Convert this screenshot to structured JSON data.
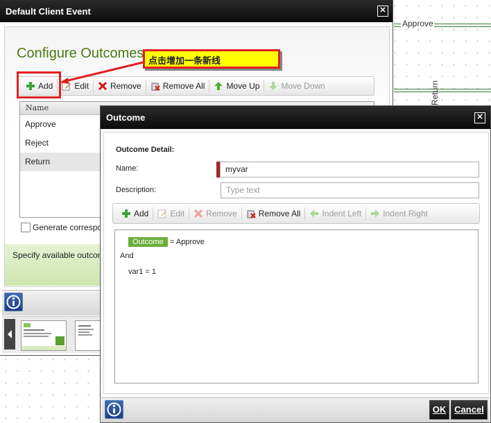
{
  "canvas": {
    "label_approve": "Approve",
    "label_return": "Return"
  },
  "main_dialog": {
    "title": "Default Client Event",
    "heading": "Configure Outcomes",
    "toolbar": {
      "add": "Add",
      "edit": "Edit",
      "remove": "Remove",
      "remove_all": "Remove All",
      "move_up": "Move Up",
      "move_down": "Move Down"
    },
    "list": {
      "header": "Name",
      "items": [
        "Approve",
        "Reject",
        "Return"
      ],
      "selected_index": 2
    },
    "checkbox_label": "Generate correspor",
    "info_text": "Specify available outcome"
  },
  "annotation": {
    "text": "点击增加一条新线"
  },
  "outcome_dialog": {
    "title": "Outcome",
    "section_title": "Outcome Detail:",
    "name_label": "Name:",
    "name_value": "myvar",
    "description_label": "Description:",
    "description_placeholder": "Type text",
    "toolbar": {
      "add": "Add",
      "edit": "Edit",
      "remove": "Remove",
      "remove_all": "Remove All",
      "indent_left": "Indent Left",
      "indent_right": "Indent Right"
    },
    "expression": {
      "tag": "Outcome",
      "line1_rest": "= Approve",
      "line2": "And",
      "line3": "var1 = 1"
    },
    "ok": "OK",
    "cancel": "Cancel"
  },
  "colors": {
    "accent_green": "#6cae3c",
    "heading_green": "#4a7a13",
    "annotation_bg": "#ffff00",
    "annotation_border": "#e02020"
  }
}
